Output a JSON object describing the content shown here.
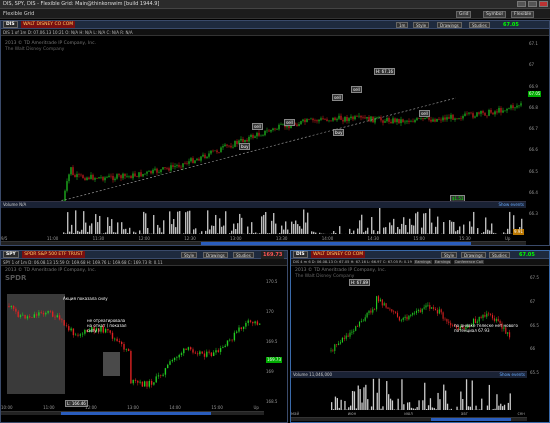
{
  "window": {
    "title": "DIS, SPY, DIS - Flexible Grid: Main@thinkorswim [build 1944.9]"
  },
  "menubar": {
    "label": "Flexible Grid",
    "buttons": [
      "Grid",
      "Symbol",
      "Flexible"
    ]
  },
  "top": {
    "symbol": "DIS",
    "description": "WALT DISNEY CO COM",
    "aggregation": "1m",
    "style": "Style",
    "drawings": "Drawings",
    "studies": "Studies",
    "price": "67.05",
    "quote": "DIS 1 of 1m  D: 07.06.13 10:21  O: N/A  H: N/A  L: N/A  C: N/A  R: N/A",
    "watermark1": "2013 © TD Ameritrade IP Company, Inc.",
    "watermark2": "The Walt Disney Company",
    "tags": {
      "hi": "H: 67.16",
      "sell1": "sell",
      "sell2": "sell",
      "buy1": "buy",
      "buy2": "buy",
      "sell3": "sell",
      "sell4": "sell",
      "buy3": "buy",
      "sell5": "sell",
      "lo": "$1.51"
    },
    "price_axis": [
      "67.1",
      "67",
      "66.9",
      "66.8",
      "66.7",
      "66.6",
      "66.5",
      "66.4",
      "66.3"
    ],
    "current_price_tag": "67.05",
    "volume": {
      "label": "Volume",
      "value": "N/A",
      "right": "Show events"
    },
    "time_axis": [
      "9/5",
      "11:00",
      "11:30",
      "12:00",
      "12:30",
      "13:00",
      "13:30",
      "14:00",
      "14:30",
      "15:00",
      "15:30",
      "Up"
    ],
    "vol_tag": "9.91"
  },
  "spy": {
    "symbol": "SPY",
    "description": "SPDR S&P 500 ETF TRUST",
    "style": "Style",
    "drawings": "Drawings",
    "studies": "Studies",
    "price": "169.73",
    "quote": "SPY 1 of 1m  D: 06.08.13 15:59  O: 169.68  H: 169.76  L: 169.68  C: 169.73  R: 0.11",
    "watermark1": "2013 © TD Ameritrade IP Company, Inc.",
    "watermark2": "SPDR",
    "annot1": "Акция показала силу",
    "annot2": "не отреагировала\nна откат ( показал\nсилу )",
    "low_tag": "L: 166.46",
    "price_axis": [
      "170.5",
      "170",
      "169.5",
      "169",
      "168.5"
    ],
    "price_tag": "169.73",
    "time_axis": [
      "10:00",
      "11:00",
      "12:00",
      "13:00",
      "14:00",
      "15:00",
      "Up"
    ]
  },
  "dis": {
    "symbol": "DIS",
    "description": "WALT DISNEY CO COM",
    "style": "Style",
    "drawings": "Drawings",
    "studies": "Studies",
    "price": "67.05",
    "quote": "DIS 4 m 6  D: 06.08.13  O: 67.05  H: 67.16  L: 66.97  C: 67.05  R: 0.19",
    "tabs": [
      "Earnings",
      "Earnings",
      "Conference Call"
    ],
    "watermark1": "2013 © TD Ameritrade IP Company, Inc.",
    "watermark2": "The Walt Disney Company",
    "hi_tag": "H: 67.89",
    "annot": "по дневке телеске нет нового\nпотенциал 67.93",
    "price_axis": [
      "67.5",
      "67",
      "66.5",
      "66",
      "65.5"
    ],
    "volume": {
      "label": "Volume",
      "value": "11,046,000",
      "right": "Show events"
    },
    "time_axis": [
      "май",
      "июн",
      "июл",
      "авг",
      "сен"
    ]
  }
}
